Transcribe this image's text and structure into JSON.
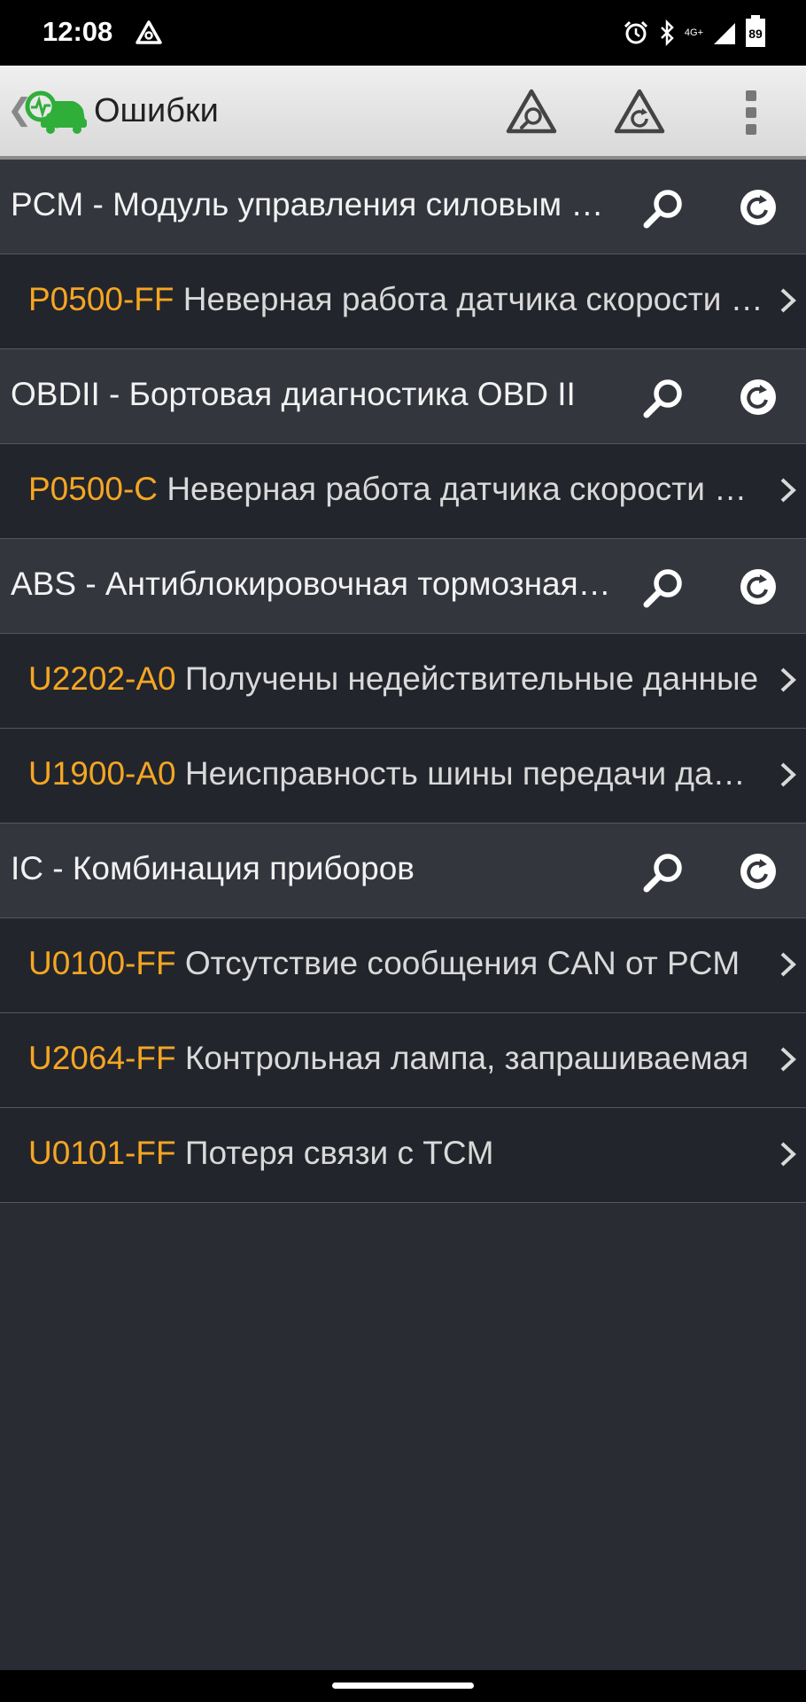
{
  "status_bar": {
    "time": "12:08",
    "network": "4G+",
    "battery": "89"
  },
  "header": {
    "title": "Ошибки"
  },
  "modules": [
    {
      "label": "PCM - Модуль управления силовым агрегатом",
      "faults": [
        {
          "code": "P0500-FF",
          "description": "Неверная работа датчика скорости автомобиля"
        }
      ]
    },
    {
      "label": "OBDII - Бортовая диагностика OBD II",
      "faults": [
        {
          "code": "P0500-C",
          "description": "Неверная работа датчика скорости автомобиля"
        }
      ]
    },
    {
      "label": "ABS - Антиблокировочная тормозная система",
      "faults": [
        {
          "code": "U2202-A0",
          "description": "Получены недействительные данные"
        },
        {
          "code": "U1900-A0",
          "description": "Неисправность шины передачи данных"
        }
      ]
    },
    {
      "label": "IC - Комбинация приборов",
      "faults": [
        {
          "code": "U0100-FF",
          "description": "Отсутствие сообщения CAN от PCM"
        },
        {
          "code": "U2064-FF",
          "description": "Контрольная лампа, запрашиваемая"
        },
        {
          "code": "U0101-FF",
          "description": "Потеря связи с TCM"
        }
      ]
    }
  ],
  "colors": {
    "code": "#f5a623",
    "module_bg": "#34363e",
    "fault_bg": "#23252c",
    "logo_green": "#2fae3a"
  },
  "icons": {
    "status": [
      "triangle-app-icon",
      "alarm-icon",
      "bluetooth-icon",
      "signal-icon",
      "battery-icon"
    ],
    "header": [
      "back-icon",
      "app-logo-icon",
      "triangle-search-icon",
      "triangle-refresh-icon",
      "overflow-menu-icon"
    ],
    "module_actions": [
      "search-icon",
      "refresh-icon"
    ],
    "fault": "chevron-right-icon"
  }
}
